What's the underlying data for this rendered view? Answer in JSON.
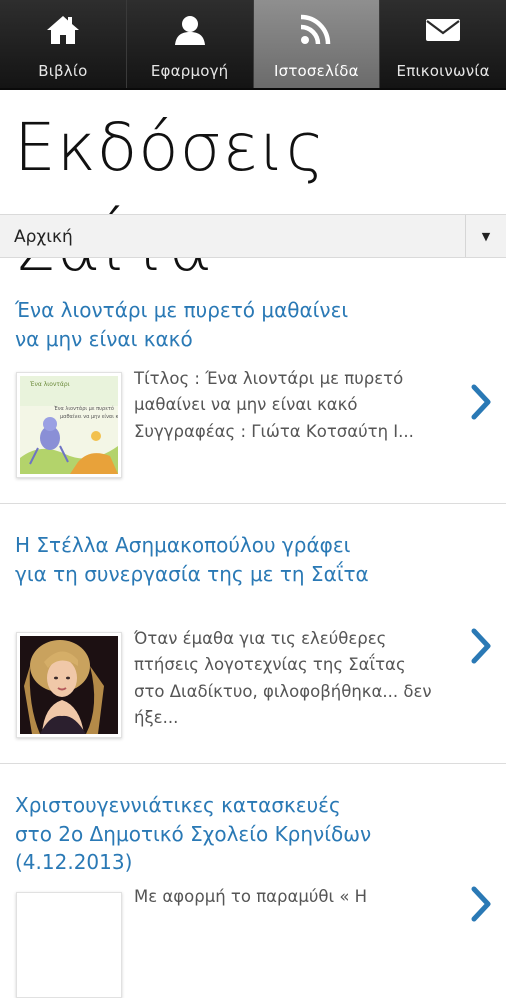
{
  "tabs": [
    {
      "label": "Βιβλίο",
      "icon": "home-icon",
      "active": false
    },
    {
      "label": "Εφαρμογή",
      "icon": "user-icon",
      "active": false
    },
    {
      "label": "Ιστοσελίδα",
      "icon": "rss-icon",
      "active": true
    },
    {
      "label": "Επικοινωνία",
      "icon": "mail-icon",
      "active": false
    }
  ],
  "logo_text": "Εκδόσεις Σαΐτα",
  "nav_select": {
    "value": "Αρχική"
  },
  "articles": [
    {
      "title": "Ένα λιοντάρι με πυρετό μαθαίνει να μην είναι κακό",
      "excerpt": "Τίτλος : Ένα λιοντάρι με πυρετό μαθαίνει να μην είναι κακό Συγγραφέας : Γιώτα Κοτσαύτη Ι...",
      "thumb_text": "Ένα λιοντάρι με πυρετό"
    },
    {
      "title": "Η Στέλλα Ασημακοπούλου γράφει για τη συνεργασία της με τη Σαΐτα",
      "excerpt": "Όταν έμαθα για τις ελεύθερες πτήσεις λογοτεχνίας της Σαΐτας στο Διαδίκτυο, φιλοφοβήθηκα... δεν ήξε...",
      "thumb_text": ""
    },
    {
      "title": "Χριστουγεννιάτικες κατασκευές στο 2ο Δημοτικό Σχολείο Κρηνίδων (4.12.2013)",
      "excerpt": "Με αφορμή το παραμύθι « Η",
      "thumb_text": ""
    }
  ],
  "colors": {
    "link": "#2a79b5",
    "chevron": "#2a79b5",
    "tab_active": "#7a7a7a"
  }
}
